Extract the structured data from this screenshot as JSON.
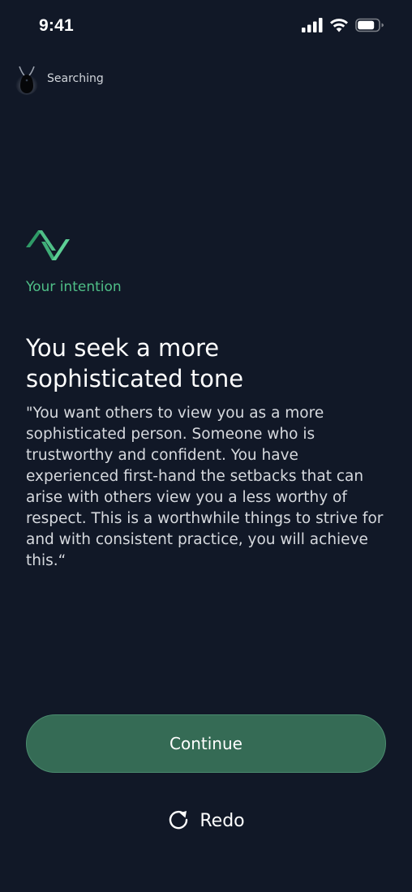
{
  "status_bar": {
    "time": "9:41"
  },
  "device": {
    "status_label": "Searching"
  },
  "intention": {
    "label": "Your intention",
    "headline": "You seek a more sophisticated tone",
    "quote": "\"You want others to view you as a more sophisticated person. Someone who is trustworthy and confident. You have experienced first-hand the setbacks that can arise with others view you a less worthy of respect. This is a worthwhile things to strive for and with consistent practice, you will achieve this.“"
  },
  "actions": {
    "continue_label": "Continue",
    "redo_label": "Redo"
  },
  "colors": {
    "background": "#111827",
    "accent_green": "#4fbf87",
    "button_green": "#356b55"
  },
  "icons": {
    "signal": "cellular-signal-icon",
    "wifi": "wifi-icon",
    "battery": "battery-icon",
    "device": "pendant-device-icon",
    "logo": "brand-logo-icon",
    "redo": "redo-icon"
  }
}
